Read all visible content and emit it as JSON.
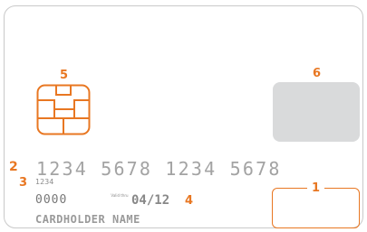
{
  "colors": {
    "accent": "#e87722",
    "card_border": "#c9c9c9",
    "gray_box": "#d9dadb"
  },
  "callouts": {
    "c1": "1",
    "c2": "2",
    "c3": "3",
    "c4": "4",
    "c5": "5",
    "c6": "6"
  },
  "card": {
    "number": "1234 5678 1234 5678",
    "small_number": "1234",
    "code": "0000",
    "valid_thru": "Valid thru",
    "expiry": "04/12",
    "cardholder": "CARDHOLDER NAME"
  }
}
